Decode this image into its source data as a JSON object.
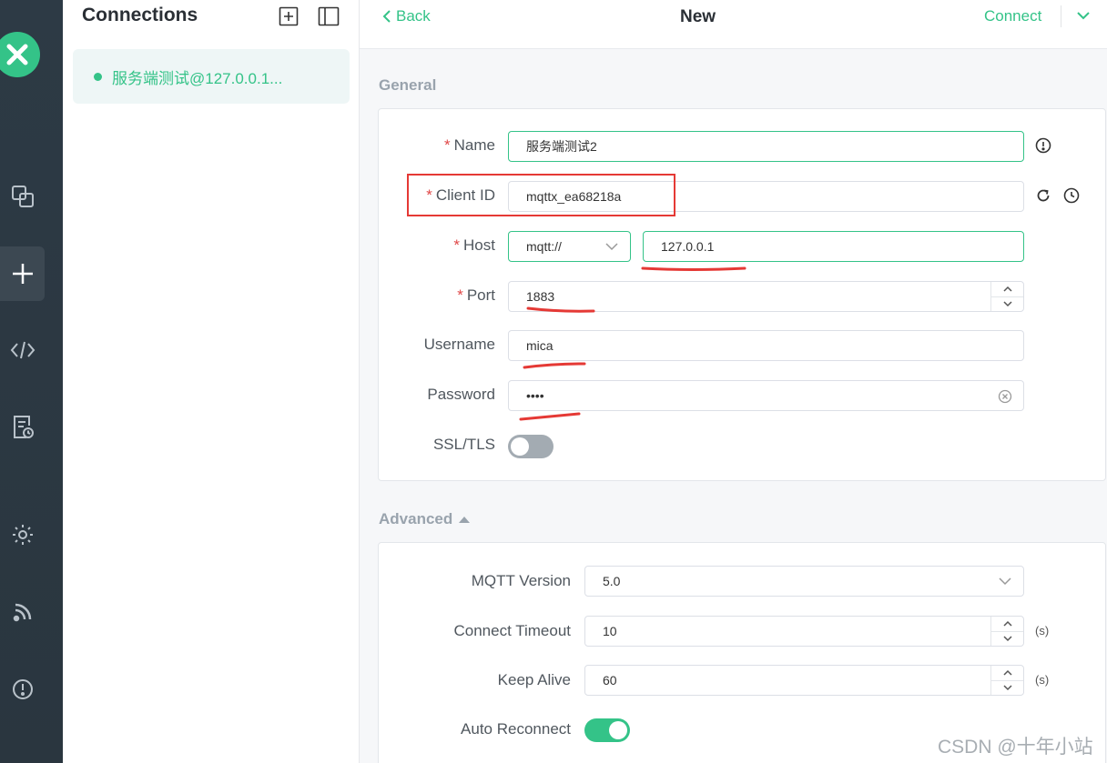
{
  "app": {
    "name": "MQTTX"
  },
  "sidebar": {
    "title": "Connections",
    "connections": [
      {
        "name": "服务端测试@127.0.0.1...",
        "status": "connected",
        "status_color": "#34c388"
      }
    ]
  },
  "header": {
    "back_label": "Back",
    "title": "New",
    "connect_label": "Connect"
  },
  "general": {
    "section_title": "General",
    "name": {
      "label": "Name",
      "required": true,
      "value": "服务端测试2"
    },
    "client_id": {
      "label": "Client ID",
      "required": true,
      "value": "mqttx_ea68218a"
    },
    "host": {
      "label": "Host",
      "required": true,
      "protocol": "mqtt://",
      "value": "127.0.0.1"
    },
    "port": {
      "label": "Port",
      "required": true,
      "value": "1883"
    },
    "username": {
      "label": "Username",
      "value": "mica"
    },
    "password": {
      "label": "Password",
      "value": "••••"
    },
    "ssl_tls": {
      "label": "SSL/TLS",
      "enabled": false
    }
  },
  "advanced": {
    "section_title": "Advanced",
    "mqtt_version": {
      "label": "MQTT Version",
      "value": "5.0"
    },
    "connect_timeout": {
      "label": "Connect Timeout",
      "value": "10",
      "unit": "(s)"
    },
    "keep_alive": {
      "label": "Keep Alive",
      "value": "60",
      "unit": "(s)"
    },
    "auto_reconnect": {
      "label": "Auto Reconnect",
      "enabled": true
    }
  },
  "colors": {
    "accent": "#34c388",
    "required": "#e04848",
    "annotation": "#e53935",
    "rail": "#2d3a45"
  },
  "watermark": "CSDN @十年小站"
}
